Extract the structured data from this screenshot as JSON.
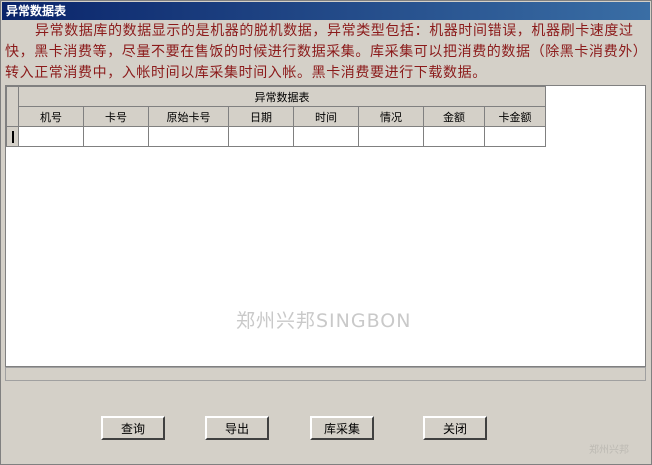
{
  "window": {
    "title": "异常数据表"
  },
  "notice": {
    "text": "异常数据库的数据显示的是机器的脱机数据，异常类型包括：机器时间错误，机器刷卡速度过快，黑卡消费等，尽量不要在售饭的时候进行数据采集。库采集可以把消费的数据（除黑卡消费外）转入正常消费中，入帐时间以库采集时间入帐。黑卡消费要进行下载数据。"
  },
  "table": {
    "caption": "异常数据表",
    "columns": [
      "机号",
      "卡号",
      "原始卡号",
      "日期",
      "时间",
      "情况",
      "金额",
      "卡金额"
    ]
  },
  "watermark": "郑州兴邦SINGBON",
  "corner_mark": "郑州兴邦",
  "buttons": {
    "query": "查询",
    "export": "导出",
    "collect": "库采集",
    "close": "关闭"
  }
}
